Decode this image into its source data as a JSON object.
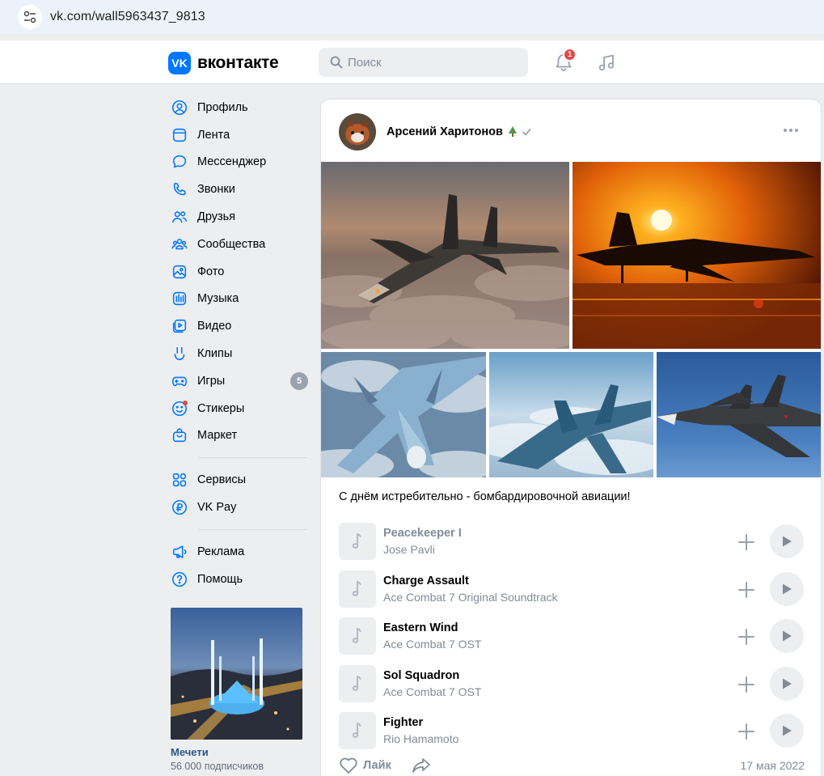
{
  "browser": {
    "url": "vk.com/wall5963437_9813"
  },
  "header": {
    "logo_text": "вконтакте",
    "logo_mark": "VK",
    "search_placeholder": "Поиск",
    "notifications_count": "1"
  },
  "sidebar": {
    "items": [
      {
        "label": "Профиль",
        "icon": "user-circle-icon"
      },
      {
        "label": "Лента",
        "icon": "newsfeed-icon"
      },
      {
        "label": "Мессенджер",
        "icon": "message-icon"
      },
      {
        "label": "Звонки",
        "icon": "phone-icon"
      },
      {
        "label": "Друзья",
        "icon": "users-icon"
      },
      {
        "label": "Сообщества",
        "icon": "communities-icon"
      },
      {
        "label": "Фото",
        "icon": "photo-icon"
      },
      {
        "label": "Музыка",
        "icon": "music-icon"
      },
      {
        "label": "Видео",
        "icon": "video-icon"
      },
      {
        "label": "Клипы",
        "icon": "clips-icon"
      },
      {
        "label": "Игры",
        "icon": "gamepad-icon",
        "count": "5"
      },
      {
        "label": "Стикеры",
        "icon": "smile-icon"
      },
      {
        "label": "Маркет",
        "icon": "shopping-bag-icon"
      }
    ],
    "secondary": [
      {
        "label": "Сервисы",
        "icon": "services-icon"
      },
      {
        "label": "VK Pay",
        "icon": "vkpay-icon"
      }
    ],
    "tertiary": [
      {
        "label": "Реклама",
        "icon": "megaphone-icon"
      },
      {
        "label": "Помощь",
        "icon": "help-icon"
      }
    ],
    "promo": {
      "title": "Мечети",
      "subtitle": "56 000 подписчиков"
    }
  },
  "post": {
    "author": "Арсений Харитонов",
    "text": "С днём истребительно - бомбардировочной авиации!",
    "date": "17 мая 2022",
    "like_label": "Лайк",
    "tracks": [
      {
        "title": "Peacekeeper I",
        "artist": "Jose Pavli",
        "dimmed": true
      },
      {
        "title": "Charge Assault",
        "artist": "Ace Combat 7 Original Soundtrack",
        "dimmed": false
      },
      {
        "title": "Eastern Wind",
        "artist": "Ace Combat 7 OST",
        "dimmed": false
      },
      {
        "title": "Sol Squadron",
        "artist": "Ace Combat 7 OST",
        "dimmed": false
      },
      {
        "title": "Fighter",
        "artist": "Rio Hamamoto",
        "dimmed": false
      }
    ]
  },
  "colors": {
    "accent": "#0077ff",
    "badge": "#e64646",
    "link": "#2a5885",
    "muted": "#818c99"
  }
}
